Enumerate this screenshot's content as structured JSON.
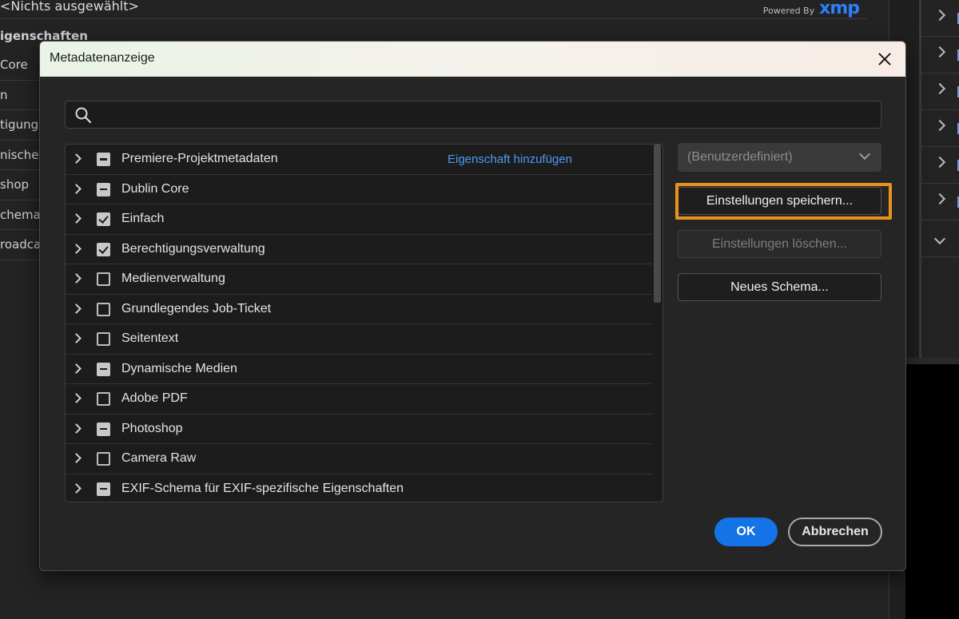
{
  "background": {
    "selection_label": "<Nichts ausgewählt>",
    "powered_by": "Powered By",
    "xmp_logo": "xmp",
    "properties_heading": "igenschaften",
    "list_items": [
      "Core",
      "n",
      "tigung",
      "nische M",
      "shop",
      "chema",
      "roadca"
    ]
  },
  "dialog": {
    "title": "Metadatenanzeige",
    "search": {
      "placeholder": "",
      "value": ""
    },
    "tree": [
      {
        "label": "Premiere-Projektmetadaten",
        "state": "mixed",
        "action": "Eigenschaft hinzufügen"
      },
      {
        "label": "Dublin Core",
        "state": "mixed"
      },
      {
        "label": "Einfach",
        "state": "checked"
      },
      {
        "label": "Berechtigungsverwaltung",
        "state": "checked"
      },
      {
        "label": "Medienverwaltung",
        "state": "unchecked"
      },
      {
        "label": "Grundlegendes Job-Ticket",
        "state": "unchecked"
      },
      {
        "label": "Seitentext",
        "state": "unchecked"
      },
      {
        "label": "Dynamische Medien",
        "state": "mixed"
      },
      {
        "label": "Adobe PDF",
        "state": "unchecked"
      },
      {
        "label": "Photoshop",
        "state": "mixed"
      },
      {
        "label": "Camera Raw",
        "state": "unchecked"
      },
      {
        "label": "EXIF-Schema für EXIF-spezifische Eigenschaften",
        "state": "mixed"
      }
    ],
    "preset_select": "(Benutzerdefiniert)",
    "save_button": "Einstellungen speichern...",
    "delete_button": "Einstellungen löschen...",
    "new_schema_button": "Neues Schema...",
    "ok_button": "OK",
    "cancel_button": "Abbrechen"
  },
  "colors": {
    "accent_blue": "#1473e6",
    "link_blue": "#4b9cf5",
    "highlight_orange": "#e8921d"
  }
}
